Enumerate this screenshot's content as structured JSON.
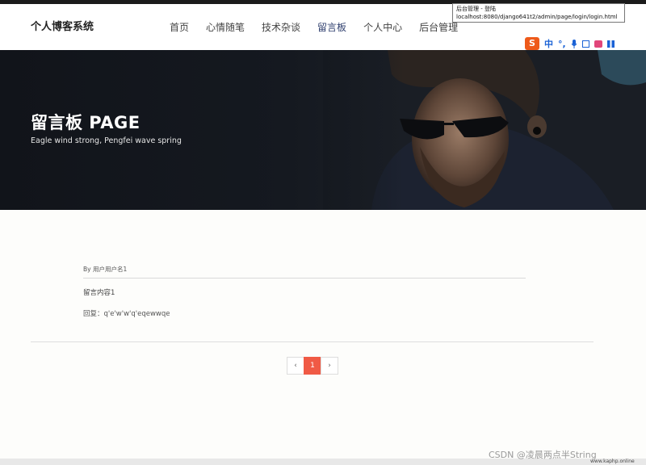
{
  "header": {
    "brand": "个人博客系统",
    "nav": [
      {
        "label": "首页"
      },
      {
        "label": "心情随笔"
      },
      {
        "label": "技术杂谈"
      },
      {
        "label": "留言板",
        "active": true
      },
      {
        "label": "个人中心"
      },
      {
        "label": "后台管理"
      }
    ]
  },
  "tooltip": {
    "title": "后台管理 - 登陆",
    "url": "localhost:8080/django641t2/admin/page/login/login.html"
  },
  "ime": {
    "logo": "S",
    "lang": "中",
    "punct": "°,"
  },
  "banner": {
    "title": "留言板 PAGE",
    "subtitle": "Eagle wind strong, Pengfei wave spring"
  },
  "message": {
    "author": "By 用户用户名1",
    "content": "留言内容1",
    "reply": "回复：q'e'w'w'q'eqewwqe"
  },
  "pagination": {
    "prev": "‹",
    "current": "1",
    "next": "›"
  },
  "watermark": {
    "csdn": "CSDN @凌晨两点半String",
    "site": "www.kaphp.online"
  },
  "colors": {
    "accent": "#f05a45",
    "nav_active": "#2f3f6e",
    "ime_logo": "#ee5a1a"
  }
}
